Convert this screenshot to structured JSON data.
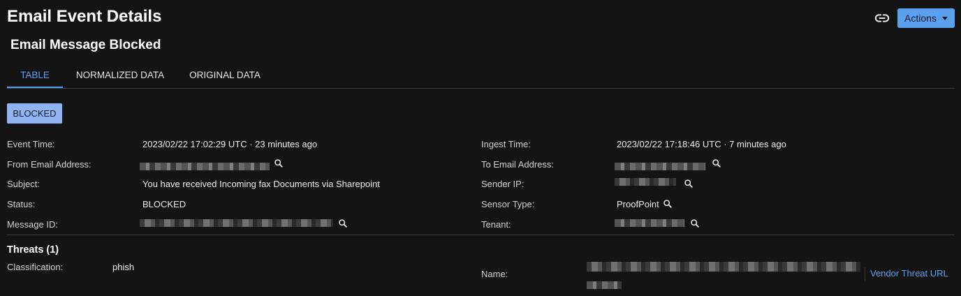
{
  "header": {
    "title": "Email Event Details",
    "actions_label": "Actions",
    "subtitle": "Email Message Blocked",
    "link_icon": "link-icon",
    "accent_color": "#5aa0ec"
  },
  "tabs": [
    {
      "label": "TABLE",
      "active": true
    },
    {
      "label": "NORMALIZED DATA",
      "active": false
    },
    {
      "label": "ORIGINAL DATA",
      "active": false
    }
  ],
  "status_badge": "BLOCKED",
  "fields_left": {
    "event_time": {
      "label": "Event Time:",
      "value": "2023/02/22 17:02:29 UTC · 23 minutes ago"
    },
    "from_email": {
      "label": "From Email Address:",
      "value": ""
    },
    "subject": {
      "label": "Subject:",
      "value": "You have received Incoming fax Documents via Sharepoint"
    },
    "status": {
      "label": "Status:",
      "value": "BLOCKED"
    },
    "message_id": {
      "label": "Message ID:",
      "value": ""
    }
  },
  "fields_right": {
    "ingest_time": {
      "label": "Ingest Time:",
      "value": "2023/02/22 17:18:46 UTC · 7 minutes ago"
    },
    "to_email": {
      "label": "To Email Address:",
      "value": ""
    },
    "sender_ip": {
      "label": "Sender IP:",
      "value": ""
    },
    "sensor_type": {
      "label": "Sensor Type:",
      "value": "ProofPoint"
    },
    "tenant": {
      "label": "Tenant:",
      "value": ""
    }
  },
  "threats": {
    "heading": "Threats (1)",
    "classification_label": "Classification:",
    "classification_value": "phish",
    "name_label": "Name:",
    "vendor_link": "Vendor Threat URL"
  }
}
